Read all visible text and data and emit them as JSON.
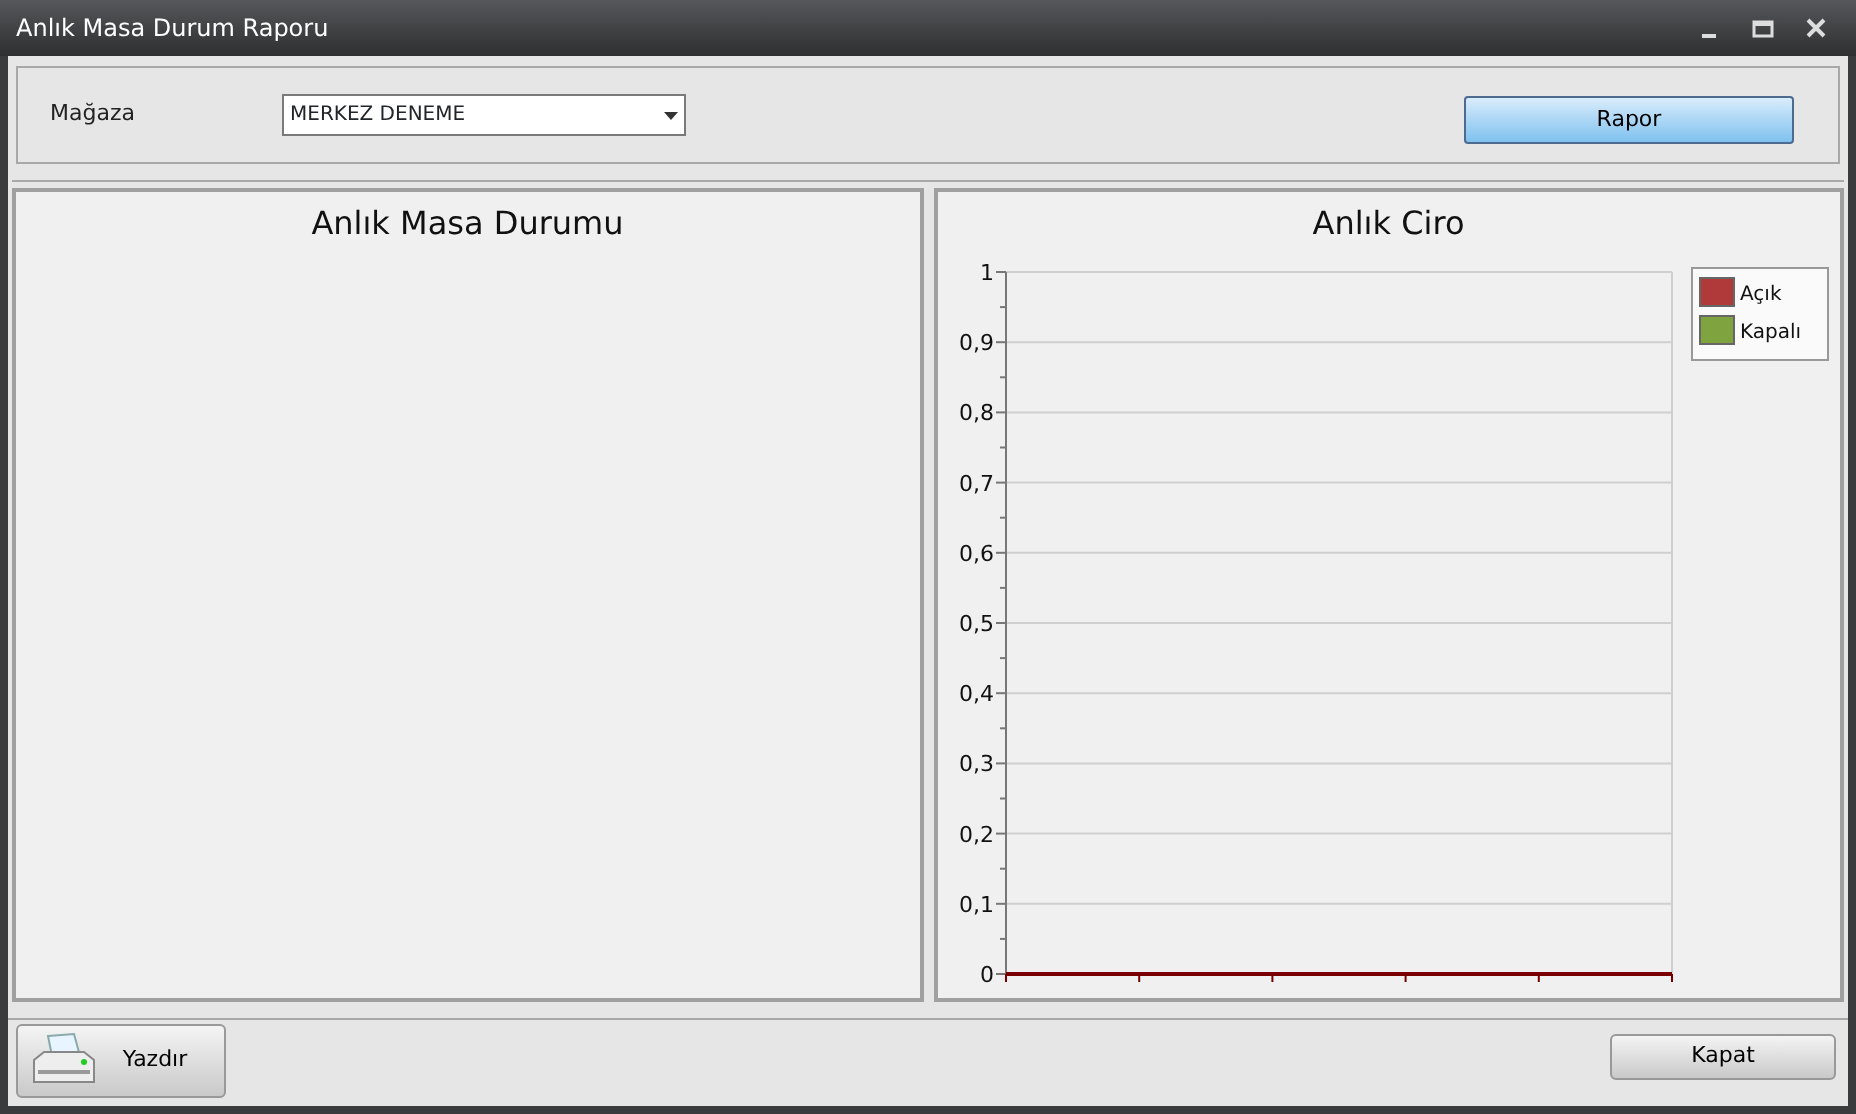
{
  "window": {
    "title": "Anlık Masa Durum Raporu"
  },
  "filter": {
    "label": "Mağaza",
    "store": "MERKEZ DENEME",
    "button": "Rapor"
  },
  "panels": [
    {
      "title": "Anlık Masa Durumu"
    },
    {
      "title": "Anlık Ciro",
      "chart_data": {
        "type": "bar",
        "grid": true,
        "ylim": [
          0,
          1
        ],
        "yticks": [
          {
            "value": 0,
            "label": "0"
          },
          {
            "value": 0.1,
            "label": "0,1"
          },
          {
            "value": 0.2,
            "label": "0,2"
          },
          {
            "value": 0.3,
            "label": "0,3"
          },
          {
            "value": 0.4,
            "label": "0,4"
          },
          {
            "value": 0.5,
            "label": "0,5"
          },
          {
            "value": 0.6,
            "label": "0,6"
          },
          {
            "value": 0.7,
            "label": "0,7"
          },
          {
            "value": 0.8,
            "label": "0,8"
          },
          {
            "value": 0.9,
            "label": "0,9"
          },
          {
            "value": 1,
            "label": "1"
          }
        ],
        "series": [
          {
            "name": "Açık",
            "color": "#b03a3a"
          },
          {
            "name": "Kapalı",
            "color": "#7fa33f"
          }
        ]
      }
    }
  ],
  "buttons": [
    {
      "label": "Yazdır",
      "kind": "print"
    },
    {
      "label": "Kapat",
      "kind": "plain"
    }
  ]
}
